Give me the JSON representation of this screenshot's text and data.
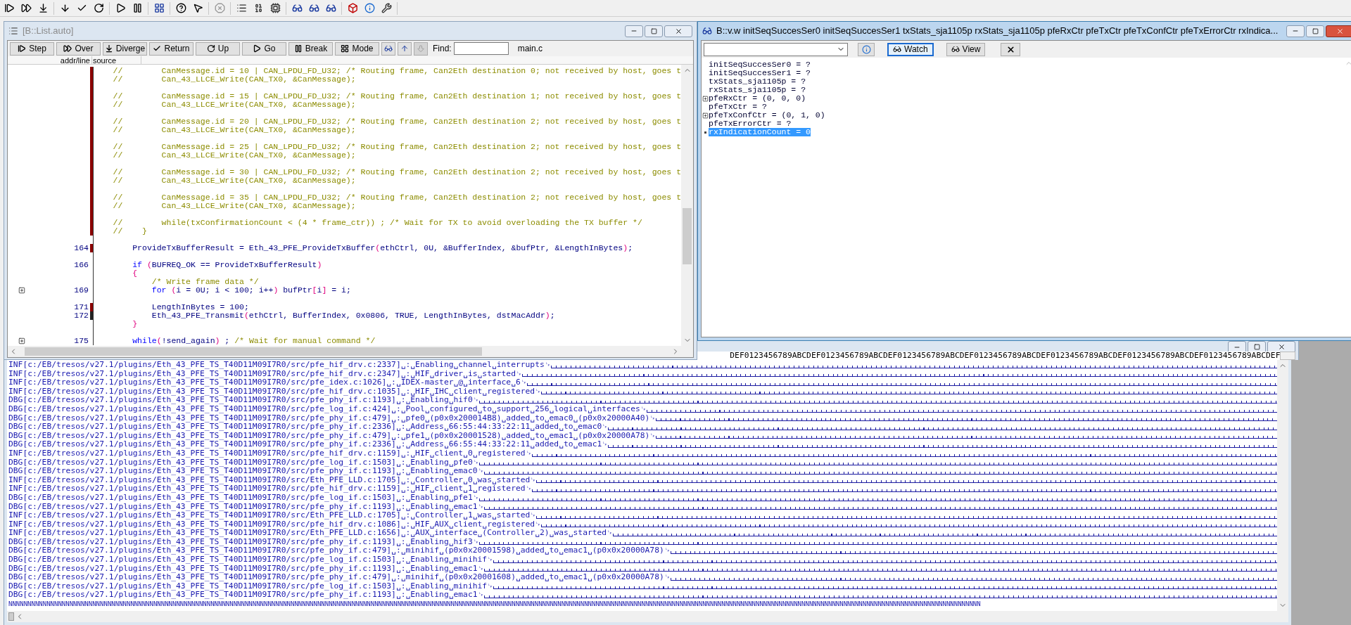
{
  "list_window": {
    "title": "[B::List.auto]",
    "active": false,
    "buttons": [
      {
        "label": "Step"
      },
      {
        "label": "Over"
      },
      {
        "label": "Diverge"
      },
      {
        "label": "Return"
      },
      {
        "label": "Up"
      },
      {
        "label": "Go"
      },
      {
        "label": "Break"
      },
      {
        "label": "Mode"
      }
    ],
    "icon_buttons": [
      {
        "disabled": false
      },
      {
        "disabled": false
      },
      {
        "disabled": true
      }
    ],
    "find_label": "Find:",
    "file": "main.c",
    "columns": [
      "addr/line",
      "source"
    ],
    "lines": [
      {
        "kind": "code",
        "color": "#8b0000",
        "expandable": false,
        "tokens": [
          {
            "kind": "comment",
            "text": "    //        CanMessage.id = 10 | CAN_LPDU_FD_U32; /* Routing frame, Can2Eth destination 0; not received by host, goes t"
          }
        ]
      },
      {
        "kind": "code",
        "color": "#8b0000",
        "expandable": false,
        "tokens": [
          {
            "kind": "comment",
            "text": "    //        Can_43_LLCE_Write(CAN_TX0, &CanMessage);"
          }
        ]
      },
      {
        "kind": "blank",
        "color": "#8b0000",
        "expandable": false
      },
      {
        "kind": "code",
        "color": "#8b0000",
        "expandable": false,
        "tokens": [
          {
            "kind": "comment",
            "text": "    //        CanMessage.id = 15 | CAN_LPDU_FD_U32; /* Routing frame, Can2Eth destination 1; not received by host, goes t"
          }
        ]
      },
      {
        "kind": "code",
        "color": "#8b0000",
        "expandable": false,
        "tokens": [
          {
            "kind": "comment",
            "text": "    //        Can_43_LLCE_Write(CAN_TX0, &CanMessage);"
          }
        ]
      },
      {
        "kind": "blank",
        "color": "#8b0000",
        "expandable": false
      },
      {
        "kind": "code",
        "color": "#8b0000",
        "expandable": false,
        "tokens": [
          {
            "kind": "comment",
            "text": "    //        CanMessage.id = 20 | CAN_LPDU_FD_U32; /* Routing frame, Can2Eth destination 2; not received by host, goes t"
          }
        ]
      },
      {
        "kind": "code",
        "color": "#8b0000",
        "expandable": false,
        "tokens": [
          {
            "kind": "comment",
            "text": "    //        Can_43_LLCE_Write(CAN_TX0, &CanMessage);"
          }
        ]
      },
      {
        "kind": "blank",
        "color": "#8b0000",
        "expandable": false
      },
      {
        "kind": "code",
        "color": "#8b0000",
        "expandable": false,
        "tokens": [
          {
            "kind": "comment",
            "text": "    //        CanMessage.id = 25 | CAN_LPDU_FD_U32; /* Routing frame, Can2Eth destination 2; not received by host, goes t"
          }
        ]
      },
      {
        "kind": "code",
        "color": "#8b0000",
        "expandable": false,
        "tokens": [
          {
            "kind": "comment",
            "text": "    //        Can_43_LLCE_Write(CAN_TX0, &CanMessage);"
          }
        ]
      },
      {
        "kind": "blank",
        "color": "#8b0000",
        "expandable": false
      },
      {
        "kind": "code",
        "color": "#8b0000",
        "expandable": false,
        "tokens": [
          {
            "kind": "comment",
            "text": "    //        CanMessage.id = 30 | CAN_LPDU_FD_U32; /* Routing frame, Can2Eth destination 2; not received by host, goes t"
          }
        ]
      },
      {
        "kind": "code",
        "color": "#8b0000",
        "expandable": false,
        "tokens": [
          {
            "kind": "comment",
            "text": "    //        Can_43_LLCE_Write(CAN_TX0, &CanMessage);"
          }
        ]
      },
      {
        "kind": "blank",
        "color": "#8b0000",
        "expandable": false
      },
      {
        "kind": "code",
        "color": "#8b0000",
        "expandable": false,
        "tokens": [
          {
            "kind": "comment",
            "text": "    //        CanMessage.id = 35 | CAN_LPDU_FD_U32; /* Routing frame, Can2Eth destination 2; not received by host, goes t"
          }
        ]
      },
      {
        "kind": "code",
        "color": "#8b0000",
        "expandable": false,
        "tokens": [
          {
            "kind": "comment",
            "text": "    //        Can_43_LLCE_Write(CAN_TX0, &CanMessage);"
          }
        ]
      },
      {
        "kind": "blank",
        "color": "#8b0000",
        "expandable": false
      },
      {
        "kind": "code",
        "color": "#8b0000",
        "expandable": false,
        "tokens": [
          {
            "kind": "comment",
            "text": "    //        while(txConfirmationCount < (4 * frame_ctr)) ; /* Wait for TX to avoid overloading the TX buffer */"
          }
        ]
      },
      {
        "kind": "code",
        "color": "#8b0000",
        "expandable": false,
        "tokens": [
          {
            "kind": "comment",
            "text": "    //    }"
          }
        ]
      },
      {
        "kind": "blank",
        "expandable": false
      },
      {
        "kind": "code",
        "line_no": "164",
        "color": "#8b0000",
        "expandable": false,
        "tokens": [
          {
            "kind": "plain",
            "text": "        ProvideTxBufferResult = Eth_43_PFE_ProvideTxBuffer"
          },
          {
            "kind": "bracket",
            "text": "("
          },
          {
            "kind": "plain",
            "text": "ethCtrl, 0U, &BufferIndex, &bufPtr, &LengthInBytes"
          },
          {
            "kind": "bracket",
            "text": ")"
          },
          {
            "kind": "plain",
            "text": ";"
          }
        ]
      },
      {
        "kind": "blank",
        "expandable": false
      },
      {
        "kind": "code",
        "line_no": "166",
        "expandable": false,
        "tokens": [
          {
            "kind": "keyword",
            "text": "        if"
          },
          {
            "kind": "bracket",
            "text": " ("
          },
          {
            "kind": "plain",
            "text": "BUFREQ_OK == ProvideTxBufferResult"
          },
          {
            "kind": "bracket",
            "text": ")"
          }
        ]
      },
      {
        "kind": "code",
        "expandable": false,
        "tokens": [
          {
            "kind": "bracket",
            "text": "        {"
          }
        ]
      },
      {
        "kind": "code",
        "expandable": false,
        "tokens": [
          {
            "kind": "comment",
            "text": "            /* Write frame data */"
          }
        ]
      },
      {
        "kind": "code",
        "line_no": "169",
        "expandable": true,
        "tokens": [
          {
            "kind": "keyword",
            "text": "            for"
          },
          {
            "kind": "bracket",
            "text": " ("
          },
          {
            "kind": "plain",
            "text": "i = 0U; i < 100; i++"
          },
          {
            "kind": "bracket",
            "text": ")"
          },
          {
            "kind": "plain",
            "text": " bufPtr"
          },
          {
            "kind": "bracket",
            "text": "["
          },
          {
            "kind": "plain",
            "text": "i"
          },
          {
            "kind": "bracket",
            "text": "]"
          },
          {
            "kind": "plain",
            "text": " = i;"
          }
        ]
      },
      {
        "kind": "blank",
        "expandable": false
      },
      {
        "kind": "code",
        "line_no": "171",
        "color": "#8b0000",
        "expandable": false,
        "tokens": [
          {
            "kind": "plain",
            "text": "            LengthInBytes = 100;"
          }
        ]
      },
      {
        "kind": "code",
        "line_no": "172",
        "color": "#222222",
        "expandable": false,
        "tokens": [
          {
            "kind": "plain",
            "text": "            Eth_43_PFE_Transmit"
          },
          {
            "kind": "bracket",
            "text": "("
          },
          {
            "kind": "plain",
            "text": "ethCtrl, BufferIndex, 0x0806, TRUE, LengthInBytes, dstMacAddr"
          },
          {
            "kind": "bracket",
            "text": ")"
          },
          {
            "kind": "plain",
            "text": ";"
          }
        ]
      },
      {
        "kind": "code",
        "expandable": false,
        "tokens": [
          {
            "kind": "bracket",
            "text": "        }"
          }
        ]
      },
      {
        "kind": "blank",
        "expandable": false
      },
      {
        "kind": "code",
        "line_no": "175",
        "expandable": true,
        "tokens": [
          {
            "kind": "keyword",
            "text": "        while"
          },
          {
            "kind": "bracket",
            "text": "("
          },
          {
            "kind": "plain",
            "text": "!send_again"
          },
          {
            "kind": "bracket",
            "text": ")"
          },
          {
            "kind": "plain",
            "text": " ; "
          },
          {
            "kind": "comment",
            "text": "/* Wait for manual command */"
          }
        ]
      }
    ]
  },
  "watch_window": {
    "title": "B::v.w initSeqSuccesSer0 initSeqSuccesSer1 txStats_sja1105p rxStats_sja1105p pfeRxCtr pfeTxCtr pfeTxConfCtr pfeTxErrorCtr rxIndica...",
    "active": true,
    "buttons": [
      {
        "label": "Watch",
        "selected": true
      },
      {
        "label": "View",
        "selected": false
      }
    ],
    "items": [
      {
        "text": "initSeqSuccesSer0 = ?",
        "expandable": false,
        "selected": false
      },
      {
        "text": "initSeqSuccesSer1 = ?",
        "expandable": false,
        "selected": false
      },
      {
        "text": "txStats_sja1105p = ?",
        "expandable": false,
        "selected": false
      },
      {
        "text": "rxStats_sja1105p = ?",
        "expandable": false,
        "selected": false
      },
      {
        "text": "pfeRxCtr = (0, 0, 0)",
        "expandable": true,
        "selected": false
      },
      {
        "text": "pfeTxCtr = ?",
        "expandable": false,
        "selected": false
      },
      {
        "text": "pfeTxConfCtr = (0, 1, 0)",
        "expandable": true,
        "selected": false
      },
      {
        "text": "pfeTxErrorCtr = ?",
        "expandable": false,
        "selected": false
      },
      {
        "text": "rxIndicationCount = 0",
        "expandable": false,
        "selected": true
      }
    ]
  },
  "log_window": {
    "header": "DEF0123456789ABCDEF0123456789ABCDEF0123456789ABCDEF0123456789ABCDEF0123456789ABCDEF0123456789ABCDEF0123456789ABCDEF",
    "lines": [
      "INF[c:/EB/tresos/v27.1/plugins/Eth_43_PFE_TS_T40D11M09I7R0/src/pfe_hif_drv.c:2337]␣:␣Enabling␣channel␣interrupts␊",
      "INF[c:/EB/tresos/v27.1/plugins/Eth_43_PFE_TS_T40D11M09I7R0/src/pfe_hif_drv.c:2347]␣:␣HIF␣driver␣is␣started␊",
      "INF[c:/EB/tresos/v27.1/plugins/Eth_43_PFE_TS_T40D11M09I7R0/src/pfe_idex.c:1026]␣:␣IDEX-master␣@␣interface␣6␊",
      "INF[c:/EB/tresos/v27.1/plugins/Eth_43_PFE_TS_T40D11M09I7R0/src/pfe_hif_drv.c:1035]␣:␣HIF␣IHC␣client␣registered␊",
      "DBG[c:/EB/tresos/v27.1/plugins/Eth_43_PFE_TS_T40D11M09I7R0/src/pfe_phy_if.c:1193]␣:␣Enabling␣hif0␊",
      "DBG[c:/EB/tresos/v27.1/plugins/Eth_43_PFE_TS_T40D11M09I7R0/src/pfe_log_if.c:424]␣:␣Pool␣configured␣to␣support␣256␣logical␣interfaces␊",
      "DBG[c:/EB/tresos/v27.1/plugins/Eth_43_PFE_TS_T40D11M09I7R0/src/pfe_phy_if.c:479]␣:␣pfe0␣(p0x0x200014B8)␣added␣to␣emac0␣(p0x0x20000A40)␊",
      "DBG[c:/EB/tresos/v27.1/plugins/Eth_43_PFE_TS_T40D11M09I7R0/src/pfe_phy_if.c:2336]␣:␣Address␣66:55:44:33:22:11␣added␣to␣emac0␊",
      "DBG[c:/EB/tresos/v27.1/plugins/Eth_43_PFE_TS_T40D11M09I7R0/src/pfe_phy_if.c:479]␣:␣pfe1␣(p0x0x20001528)␣added␣to␣emac1␣(p0x0x20000A78)␊",
      "DBG[c:/EB/tresos/v27.1/plugins/Eth_43_PFE_TS_T40D11M09I7R0/src/pfe_phy_if.c:2336]␣:␣Address␣66:55:44:33:22:11␣added␣to␣emac1␊",
      "INF[c:/EB/tresos/v27.1/plugins/Eth_43_PFE_TS_T40D11M09I7R0/src/pfe_hif_drv.c:1159]␣:␣HIF␣client␣0␣registered␊",
      "DBG[c:/EB/tresos/v27.1/plugins/Eth_43_PFE_TS_T40D11M09I7R0/src/pfe_log_if.c:1503]␣:␣Enabling␣pfe0␊",
      "DBG[c:/EB/tresos/v27.1/plugins/Eth_43_PFE_TS_T40D11M09I7R0/src/pfe_phy_if.c:1193]␣:␣Enabling␣emac0␊",
      "INF[c:/EB/tresos/v27.1/plugins/Eth_43_PFE_TS_T40D11M09I7R0/src/Eth_PFE_LLD.c:1705]␣:␣Controller␣0␣was␣started␊",
      "INF[c:/EB/tresos/v27.1/plugins/Eth_43_PFE_TS_T40D11M09I7R0/src/pfe_hif_drv.c:1159]␣:␣HIF␣client␣1␣registered␊",
      "DBG[c:/EB/tresos/v27.1/plugins/Eth_43_PFE_TS_T40D11M09I7R0/src/pfe_log_if.c:1503]␣:␣Enabling␣pfe1␊",
      "DBG[c:/EB/tresos/v27.1/plugins/Eth_43_PFE_TS_T40D11M09I7R0/src/pfe_phy_if.c:1193]␣:␣Enabling␣emac1␊",
      "INF[c:/EB/tresos/v27.1/plugins/Eth_43_PFE_TS_T40D11M09I7R0/src/Eth_PFE_LLD.c:1705]␣:␣Controller␣1␣was␣started␊",
      "INF[c:/EB/tresos/v27.1/plugins/Eth_43_PFE_TS_T40D11M09I7R0/src/pfe_hif_drv.c:1086]␣:␣HIF␣AUX␣client␣registered␊",
      "INF[c:/EB/tresos/v27.1/plugins/Eth_43_PFE_TS_T40D11M09I7R0/src/Eth_PFE_LLD.c:1656]␣:␣AUX␣interface␣(Controller␣2)␣was␣started␊",
      "DBG[c:/EB/tresos/v27.1/plugins/Eth_43_PFE_TS_T40D11M09I7R0/src/pfe_phy_if.c:1193]␣:␣Enabling␣hif3␊",
      "DBG[c:/EB/tresos/v27.1/plugins/Eth_43_PFE_TS_T40D11M09I7R0/src/pfe_phy_if.c:479]␣:␣minihif␣(p0x0x20001598)␣added␣to␣emac1␣(p0x0x20000A78)␊",
      "DBG[c:/EB/tresos/v27.1/plugins/Eth_43_PFE_TS_T40D11M09I7R0/src/pfe_log_if.c:1503]␣:␣Enabling␣minihif␊",
      "DBG[c:/EB/tresos/v27.1/plugins/Eth_43_PFE_TS_T40D11M09I7R0/src/pfe_phy_if.c:1193]␣:␣Enabling␣emac1␊",
      "DBG[c:/EB/tresos/v27.1/plugins/Eth_43_PFE_TS_T40D11M09I7R0/src/pfe_phy_if.c:479]␣:␣minihif␣(p0x0x20001608)␣added␣to␣emac1␣(p0x0x20000A78)␊",
      "DBG[c:/EB/tresos/v27.1/plugins/Eth_43_PFE_TS_T40D11M09I7R0/src/pfe_log_if.c:1503]␣:␣Enabling␣minihif␊",
      "DBG[c:/EB/tresos/v27.1/plugins/Eth_43_PFE_TS_T40D11M09I7R0/src/pfe_phy_if.c:1193]␣:␣Enabling␣emac1␊"
    ],
    "filler": "NNNNNNNNNNNNNNNNNNNNNNNNNNNNNNNNNNNNNNNNNNNNNNNNNNNNNNNNNNNNNNNNNNNNNNNNNNNNNNNNNNNNNNNNNNNNNNNNNNNNNNNNNNNNNNNNNNNNNNNNNNNNNNNNNNNNNNNNNNNNNNNNNNNNNNNNNNNNNNNNNNNNNNNNNNNNNNNNNNNNNNNNNNNNNNNNNNNNNNNNNNNNNNNNNNNNNNNNNNNNNNNNNNNNNNNNNNNNNNNNNNNNNNNNNNNNNNN"
  }
}
